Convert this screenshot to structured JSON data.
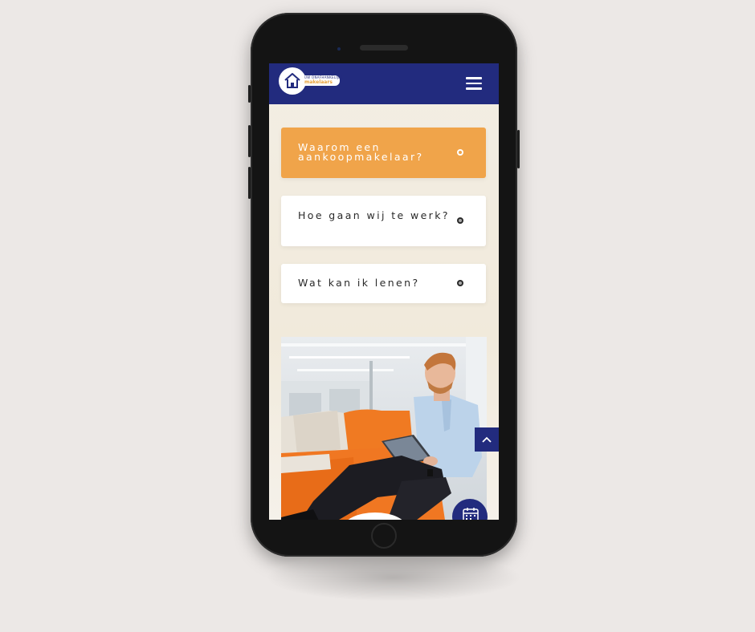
{
  "header": {
    "logo_small_text": "UW ONAFHANKELIJKE",
    "logo_brand_text": "makelaars",
    "menu_icon": "hamburger-menu-icon"
  },
  "accordion": [
    {
      "label": "Waarom een aankoopmakelaar?",
      "state": "active"
    },
    {
      "label": "Hoe gaan wij te werk?",
      "state": "collapsed"
    },
    {
      "label": "Wat kan ik lenen?",
      "state": "collapsed"
    }
  ],
  "colors": {
    "header_bg": "#222b7e",
    "accent_orange": "#f0a44a",
    "page_bg": "#ece8e6",
    "card_bg": "#ffffff"
  },
  "floating": {
    "back_to_top_icon": "chevron-up-icon",
    "calendar_icon": "calendar-icon"
  }
}
